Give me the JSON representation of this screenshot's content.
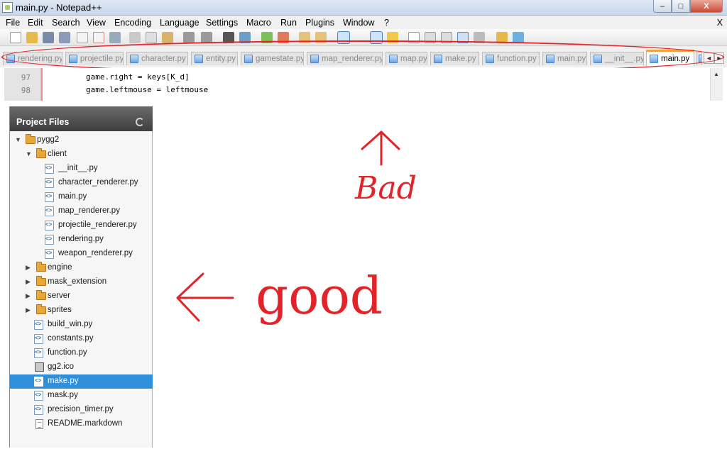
{
  "window": {
    "title": "main.py - Notepad++",
    "buttons": {
      "minimize": "–",
      "maximize": "□",
      "close": "X"
    }
  },
  "menu": {
    "items": [
      "File",
      "Edit",
      "Search",
      "View",
      "Encoding",
      "Language",
      "Settings",
      "Macro",
      "Run",
      "Plugins",
      "Window",
      "?"
    ],
    "close_x": "X"
  },
  "tabs": {
    "items": [
      "rendering.py",
      "projectile.py",
      "character.py",
      "entity.py",
      "gamestate.py",
      "map_renderer.py",
      "map.py",
      "make.py",
      "function.py",
      "main.py",
      "__init__.py",
      "main.py"
    ],
    "active_index": 11,
    "scroll_left": "◄",
    "scroll_right": "►"
  },
  "editor": {
    "lines": [
      {
        "number": "97",
        "code": "game.right = keys[K_d]"
      },
      {
        "number": "98",
        "code": "game.leftmouse = leftmouse"
      }
    ]
  },
  "project_panel": {
    "title": "Project Files",
    "tree": [
      {
        "label": "pygg2",
        "type": "folder",
        "expanded": true
      },
      {
        "label": "client",
        "type": "folder",
        "expanded": true
      },
      {
        "label": "__init__.py",
        "type": "py"
      },
      {
        "label": "character_renderer.py",
        "type": "py"
      },
      {
        "label": "main.py",
        "type": "py"
      },
      {
        "label": "map_renderer.py",
        "type": "py"
      },
      {
        "label": "projectile_renderer.py",
        "type": "py"
      },
      {
        "label": "rendering.py",
        "type": "py"
      },
      {
        "label": "weapon_renderer.py",
        "type": "py"
      },
      {
        "label": "engine",
        "type": "folder",
        "expanded": false
      },
      {
        "label": "mask_extension",
        "type": "folder",
        "expanded": false
      },
      {
        "label": "server",
        "type": "folder",
        "expanded": false
      },
      {
        "label": "sprites",
        "type": "folder",
        "expanded": false
      },
      {
        "label": "build_win.py",
        "type": "py"
      },
      {
        "label": "constants.py",
        "type": "py"
      },
      {
        "label": "function.py",
        "type": "py"
      },
      {
        "label": "gg2.ico",
        "type": "ico"
      },
      {
        "label": "make.py",
        "type": "py",
        "selected": true
      },
      {
        "label": "mask.py",
        "type": "py"
      },
      {
        "label": "precision_timer.py",
        "type": "py"
      },
      {
        "label": "README.markdown",
        "type": "doc"
      }
    ]
  },
  "annotations": {
    "bad_label": "Bad",
    "good_label": "good",
    "color": "#e2242a"
  },
  "colors": {
    "selection": "#2f8fdb",
    "active_tab_accent": "#f3a23b",
    "panel_header": "#4a4a4a"
  }
}
